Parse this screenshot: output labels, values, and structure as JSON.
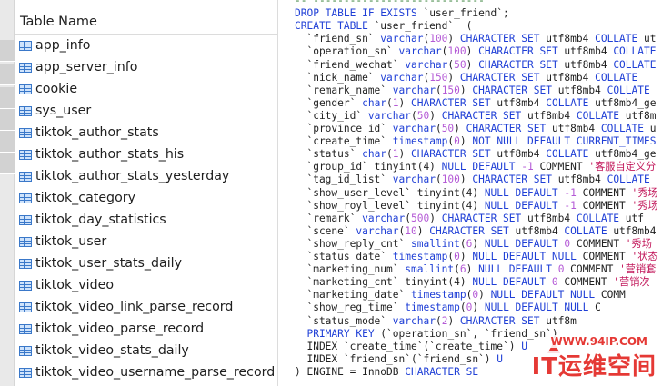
{
  "table_list": {
    "header": "Table Name",
    "items": [
      "app_info",
      "app_server_info",
      "cookie",
      "sys_user",
      "tiktok_author_stats",
      "tiktok_author_stats_his",
      "tiktok_author_stats_yesterday",
      "tiktok_category",
      "tiktok_day_statistics",
      "tiktok_user",
      "tiktok_user_stats_daily",
      "tiktok_video",
      "tiktok_video_link_parse_record",
      "tiktok_video_parse_record",
      "tiktok_video_stats_daily",
      "tiktok_video_username_parse_record"
    ]
  },
  "code": {
    "lines": [
      [
        {
          "t": "-- ",
          "c": "dash"
        },
        {
          "t": "----------------------------",
          "c": "dash"
        }
      ],
      [
        {
          "t": "DROP TABLE IF EXISTS ",
          "c": "kw"
        },
        {
          "t": "`user_friend`;",
          "c": "str"
        }
      ],
      [
        {
          "t": "CREATE TABLE ",
          "c": "kw"
        },
        {
          "t": "`user_friend`  (",
          "c": "str"
        }
      ],
      [
        {
          "t": "  `friend_sn` ",
          "c": "str"
        },
        {
          "t": "varchar",
          "c": "kw"
        },
        {
          "t": "(",
          "c": "str"
        },
        {
          "t": "100",
          "c": "num"
        },
        {
          "t": ") ",
          "c": "str"
        },
        {
          "t": "CHARACTER SET ",
          "c": "kw"
        },
        {
          "t": "utf8mb4 ",
          "c": "str"
        },
        {
          "t": "COLLATE ",
          "c": "kw"
        },
        {
          "t": "ut",
          "c": "str"
        }
      ],
      [
        {
          "t": "  `operation_sn` ",
          "c": "str"
        },
        {
          "t": "varchar",
          "c": "kw"
        },
        {
          "t": "(",
          "c": "str"
        },
        {
          "t": "100",
          "c": "num"
        },
        {
          "t": ") ",
          "c": "str"
        },
        {
          "t": "CHARACTER SET ",
          "c": "kw"
        },
        {
          "t": "utf8mb4 ",
          "c": "str"
        },
        {
          "t": "COLLATE",
          "c": "kw"
        }
      ],
      [
        {
          "t": "  `friend_wechat` ",
          "c": "str"
        },
        {
          "t": "varchar",
          "c": "kw"
        },
        {
          "t": "(",
          "c": "str"
        },
        {
          "t": "50",
          "c": "num"
        },
        {
          "t": ") ",
          "c": "str"
        },
        {
          "t": "CHARACTER SET ",
          "c": "kw"
        },
        {
          "t": "utf8mb4 ",
          "c": "str"
        },
        {
          "t": "COLLATE",
          "c": "kw"
        }
      ],
      [
        {
          "t": "  `nick_name` ",
          "c": "str"
        },
        {
          "t": "varchar",
          "c": "kw"
        },
        {
          "t": "(",
          "c": "str"
        },
        {
          "t": "150",
          "c": "num"
        },
        {
          "t": ") ",
          "c": "str"
        },
        {
          "t": "CHARACTER SET ",
          "c": "kw"
        },
        {
          "t": "utf8mb4 ",
          "c": "str"
        },
        {
          "t": "COLLATE",
          "c": "kw"
        }
      ],
      [
        {
          "t": "  `remark_name` ",
          "c": "str"
        },
        {
          "t": "varchar",
          "c": "kw"
        },
        {
          "t": "(",
          "c": "str"
        },
        {
          "t": "150",
          "c": "num"
        },
        {
          "t": ") ",
          "c": "str"
        },
        {
          "t": "CHARACTER SET ",
          "c": "kw"
        },
        {
          "t": "utf8mb4 ",
          "c": "str"
        },
        {
          "t": "COLLATE",
          "c": "kw"
        }
      ],
      [
        {
          "t": "  `gender` ",
          "c": "str"
        },
        {
          "t": "char",
          "c": "kw"
        },
        {
          "t": "(",
          "c": "str"
        },
        {
          "t": "1",
          "c": "num"
        },
        {
          "t": ") ",
          "c": "str"
        },
        {
          "t": "CHARACTER SET ",
          "c": "kw"
        },
        {
          "t": "utf8mb4 ",
          "c": "str"
        },
        {
          "t": "COLLATE ",
          "c": "kw"
        },
        {
          "t": "utf8mb4_ge",
          "c": "str"
        }
      ],
      [
        {
          "t": "  `city_id` ",
          "c": "str"
        },
        {
          "t": "varchar",
          "c": "kw"
        },
        {
          "t": "(",
          "c": "str"
        },
        {
          "t": "50",
          "c": "num"
        },
        {
          "t": ") ",
          "c": "str"
        },
        {
          "t": "CHARACTER SET ",
          "c": "kw"
        },
        {
          "t": "utf8mb4 ",
          "c": "str"
        },
        {
          "t": "COLLATE ",
          "c": "kw"
        },
        {
          "t": "utf8m",
          "c": "str"
        }
      ],
      [
        {
          "t": "  `province_id` ",
          "c": "str"
        },
        {
          "t": "varchar",
          "c": "kw"
        },
        {
          "t": "(",
          "c": "str"
        },
        {
          "t": "50",
          "c": "num"
        },
        {
          "t": ") ",
          "c": "str"
        },
        {
          "t": "CHARACTER SET ",
          "c": "kw"
        },
        {
          "t": "utf8mb4 ",
          "c": "str"
        },
        {
          "t": "COLLATE ",
          "c": "kw"
        },
        {
          "t": "u",
          "c": "str"
        }
      ],
      [
        {
          "t": "  `create_time` ",
          "c": "str"
        },
        {
          "t": "timestamp",
          "c": "kw"
        },
        {
          "t": "(",
          "c": "str"
        },
        {
          "t": "0",
          "c": "num"
        },
        {
          "t": ") ",
          "c": "str"
        },
        {
          "t": "NOT NULL DEFAULT CURRENT_TIMES",
          "c": "kw"
        }
      ],
      [
        {
          "t": "  `status` ",
          "c": "str"
        },
        {
          "t": "char",
          "c": "kw"
        },
        {
          "t": "(",
          "c": "str"
        },
        {
          "t": "1",
          "c": "num"
        },
        {
          "t": ") ",
          "c": "str"
        },
        {
          "t": "CHARACTER SET ",
          "c": "kw"
        },
        {
          "t": "utf8mb4 ",
          "c": "str"
        },
        {
          "t": "COLLATE ",
          "c": "kw"
        },
        {
          "t": "utf8mb4_ge",
          "c": "str"
        }
      ],
      [
        {
          "t": "  `group_id` ",
          "c": "str"
        },
        {
          "t": "tinyint(4) ",
          "c": "str"
        },
        {
          "t": "NULL DEFAULT ",
          "c": "kw"
        },
        {
          "t": "-1 ",
          "c": "num"
        },
        {
          "t": "COMMENT ",
          "c": "str"
        },
        {
          "t": "'客服自定义分",
          "c": "cmt-str"
        }
      ],
      [
        {
          "t": "  `tag_id_list` ",
          "c": "str"
        },
        {
          "t": "varchar",
          "c": "kw"
        },
        {
          "t": "(",
          "c": "str"
        },
        {
          "t": "100",
          "c": "num"
        },
        {
          "t": ") ",
          "c": "str"
        },
        {
          "t": "CHARACTER SET ",
          "c": "kw"
        },
        {
          "t": "utf8mb4 ",
          "c": "str"
        },
        {
          "t": "COLLATE",
          "c": "kw"
        }
      ],
      [
        {
          "t": "  `show_user_level` ",
          "c": "str"
        },
        {
          "t": "tinyint(4) ",
          "c": "str"
        },
        {
          "t": "NULL DEFAULT ",
          "c": "kw"
        },
        {
          "t": "-1 ",
          "c": "num"
        },
        {
          "t": "COMMENT ",
          "c": "str"
        },
        {
          "t": "'秀场",
          "c": "cmt-str"
        }
      ],
      [
        {
          "t": "  `show_royl_level` ",
          "c": "str"
        },
        {
          "t": "tinyint(4) ",
          "c": "str"
        },
        {
          "t": "NULL DEFAULT ",
          "c": "kw"
        },
        {
          "t": "-1 ",
          "c": "num"
        },
        {
          "t": "COMMENT ",
          "c": "str"
        },
        {
          "t": "'秀场",
          "c": "cmt-str"
        }
      ],
      [
        {
          "t": "  `remark` ",
          "c": "str"
        },
        {
          "t": "varchar",
          "c": "kw"
        },
        {
          "t": "(",
          "c": "str"
        },
        {
          "t": "500",
          "c": "num"
        },
        {
          "t": ") ",
          "c": "str"
        },
        {
          "t": "CHARACTER SET ",
          "c": "kw"
        },
        {
          "t": "utf8mb4 ",
          "c": "str"
        },
        {
          "t": "COLLATE ",
          "c": "kw"
        },
        {
          "t": "utf",
          "c": "str"
        }
      ],
      [
        {
          "t": "  `scene` ",
          "c": "str"
        },
        {
          "t": "varchar",
          "c": "kw"
        },
        {
          "t": "(",
          "c": "str"
        },
        {
          "t": "10",
          "c": "num"
        },
        {
          "t": ") ",
          "c": "str"
        },
        {
          "t": "CHARACTER SET ",
          "c": "kw"
        },
        {
          "t": "utf8mb4 ",
          "c": "str"
        },
        {
          "t": "COLLATE ",
          "c": "kw"
        },
        {
          "t": "utf8mb4",
          "c": "str"
        }
      ],
      [
        {
          "t": "  `show_reply_cnt` ",
          "c": "str"
        },
        {
          "t": "smallint",
          "c": "kw"
        },
        {
          "t": "(",
          "c": "str"
        },
        {
          "t": "6",
          "c": "num"
        },
        {
          "t": ") ",
          "c": "str"
        },
        {
          "t": "NULL DEFAULT ",
          "c": "kw"
        },
        {
          "t": "0 ",
          "c": "num"
        },
        {
          "t": "COMMENT ",
          "c": "str"
        },
        {
          "t": "'秀场",
          "c": "cmt-str"
        }
      ],
      [
        {
          "t": "  `status_date` ",
          "c": "str"
        },
        {
          "t": "timestamp",
          "c": "kw"
        },
        {
          "t": "(",
          "c": "str"
        },
        {
          "t": "0",
          "c": "num"
        },
        {
          "t": ") ",
          "c": "str"
        },
        {
          "t": "NULL DEFAULT NULL ",
          "c": "kw"
        },
        {
          "t": "COMMENT ",
          "c": "str"
        },
        {
          "t": "'状态",
          "c": "cmt-str"
        }
      ],
      [
        {
          "t": "  `marketing_num` ",
          "c": "str"
        },
        {
          "t": "smallint",
          "c": "kw"
        },
        {
          "t": "(",
          "c": "str"
        },
        {
          "t": "6",
          "c": "num"
        },
        {
          "t": ") ",
          "c": "str"
        },
        {
          "t": "NULL DEFAULT ",
          "c": "kw"
        },
        {
          "t": "0 ",
          "c": "num"
        },
        {
          "t": "COMMENT ",
          "c": "str"
        },
        {
          "t": "'营销套",
          "c": "cmt-str"
        }
      ],
      [
        {
          "t": "  `marketing_cnt` ",
          "c": "str"
        },
        {
          "t": "tinyint(4) ",
          "c": "str"
        },
        {
          "t": "NULL DEFAULT ",
          "c": "kw"
        },
        {
          "t": "0 ",
          "c": "num"
        },
        {
          "t": "COMMENT ",
          "c": "str"
        },
        {
          "t": "'营销次",
          "c": "cmt-str"
        }
      ],
      [
        {
          "t": "  `marketing_date` ",
          "c": "str"
        },
        {
          "t": "timestamp",
          "c": "kw"
        },
        {
          "t": "(",
          "c": "str"
        },
        {
          "t": "0",
          "c": "num"
        },
        {
          "t": ") ",
          "c": "str"
        },
        {
          "t": "NULL DEFAULT NULL ",
          "c": "kw"
        },
        {
          "t": "COMM",
          "c": "str"
        }
      ],
      [
        {
          "t": "  `show_reg_time` ",
          "c": "str"
        },
        {
          "t": "timestamp",
          "c": "kw"
        },
        {
          "t": "(",
          "c": "str"
        },
        {
          "t": "0",
          "c": "num"
        },
        {
          "t": ") ",
          "c": "str"
        },
        {
          "t": "NULL DEFAULT NULL ",
          "c": "kw"
        },
        {
          "t": "C",
          "c": "str"
        }
      ],
      [
        {
          "t": "  `status_mode` ",
          "c": "str"
        },
        {
          "t": "varchar",
          "c": "kw"
        },
        {
          "t": "(",
          "c": "str"
        },
        {
          "t": "2",
          "c": "num"
        },
        {
          "t": ") ",
          "c": "str"
        },
        {
          "t": "CHARACTER SET ",
          "c": "kw"
        },
        {
          "t": "utf8m",
          "c": "str"
        }
      ],
      [
        {
          "t": "  PRIMARY KEY ",
          "c": "kw"
        },
        {
          "t": "(`operation_sn`, `friend_sn`)",
          "c": "str"
        }
      ],
      [
        {
          "t": "  INDEX ",
          "c": "str"
        },
        {
          "t": "`create_time`(`create_time`) ",
          "c": "str"
        },
        {
          "t": "U",
          "c": "kw"
        }
      ],
      [
        {
          "t": "  INDEX ",
          "c": "str"
        },
        {
          "t": "`friend_sn`(`friend_sn`) ",
          "c": "str"
        },
        {
          "t": "U",
          "c": "kw"
        }
      ],
      [
        {
          "t": ") ENGINE = InnoDB ",
          "c": "str"
        },
        {
          "t": "CHARACTER SE",
          "c": "kw"
        }
      ]
    ]
  },
  "watermark": {
    "url": "WWW.94IP.COM",
    "brand": "IT运维空间"
  },
  "colors": {
    "keyword": "#1f3fd6",
    "number": "#b45ad6",
    "comment_string": "#c2185b",
    "watermark": "#e53935"
  }
}
